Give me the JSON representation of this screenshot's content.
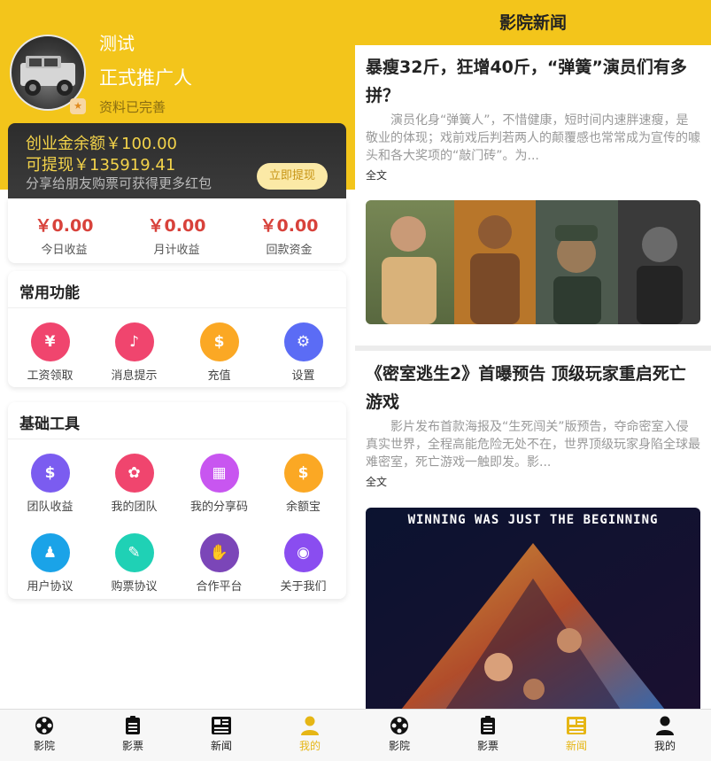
{
  "profile": {
    "name": "测试",
    "role": "正式推广人",
    "status": "资料已完善",
    "badge_icon": "★"
  },
  "wallet": {
    "balance_text": "创业金余额￥100.00",
    "withdrawable_text": "可提现￥135919.41",
    "hint": "分享给朋友购票可获得更多红包",
    "withdraw_button": "立即提现"
  },
  "stats": [
    {
      "value": "￥0.00",
      "label": "今日收益"
    },
    {
      "value": "￥0.00",
      "label": "月计收益"
    },
    {
      "value": "￥0.00",
      "label": "回款资金"
    }
  ],
  "common": {
    "title": "常用功能",
    "items": [
      {
        "label": "工资领取",
        "icon": "wallet-icon",
        "glyph": "¥",
        "color": "#f0456e"
      },
      {
        "label": "消息提示",
        "icon": "bell-icon",
        "glyph": "♪",
        "color": "#f0456e"
      },
      {
        "label": "充值",
        "icon": "coin-icon",
        "glyph": "$",
        "color": "#fba824"
      },
      {
        "label": "设置",
        "icon": "gear-icon",
        "glyph": "⚙",
        "color": "#5b6cf5"
      }
    ]
  },
  "tools": {
    "title": "基础工具",
    "items": [
      {
        "label": "团队收益",
        "icon": "money-bag-icon",
        "glyph": "$",
        "color": "#7b5cf0"
      },
      {
        "label": "我的团队",
        "icon": "award-icon",
        "glyph": "✿",
        "color": "#f0456e"
      },
      {
        "label": "我的分享码",
        "icon": "qrcode-icon",
        "glyph": "▦",
        "color": "#c856f0"
      },
      {
        "label": "余额宝",
        "icon": "money-bag-icon",
        "glyph": "$",
        "color": "#fba824"
      },
      {
        "label": "用户协议",
        "icon": "user-bag-icon",
        "glyph": "♟",
        "color": "#1aa3e8"
      },
      {
        "label": "购票协议",
        "icon": "pen-icon",
        "glyph": "✎",
        "color": "#1fd1b5"
      },
      {
        "label": "合作平台",
        "icon": "handshake-icon",
        "glyph": "✋",
        "color": "#7b46b8"
      },
      {
        "label": "关于我们",
        "icon": "lock-icon",
        "glyph": "◉",
        "color": "#8a4df0"
      }
    ]
  },
  "tabbar_left": [
    {
      "label": "影院",
      "icon": "film-reel-icon"
    },
    {
      "label": "影票",
      "icon": "ticket-icon"
    },
    {
      "label": "新闻",
      "icon": "news-icon"
    },
    {
      "label": "我的",
      "icon": "user-icon",
      "active": true
    }
  ],
  "news": {
    "header": "影院新闻",
    "articles": [
      {
        "title": "暴瘦32斤，狂增40斤，“弹簧”演员们有多拼？",
        "summary": "演员化身“弹簧人”，不惜健康，短时间内速胖速瘦，是敬业的体现；戏前戏后判若两人的颠覆感也常常成为宣传的噱头和各大奖项的“敲门砖”。为...",
        "more": "全文"
      },
      {
        "title": "《密室逃生2》首曝预告 顶级玩家重启死亡游戏",
        "summary": "影片发布首款海报及“生死闯关”版预告，夺命密室入侵真实世界，全程高能危险无处不在，世界顶级玩家身陷全球最难密室，死亡游戏一触即发。影...",
        "more": "全文",
        "poster_text": "WINNING WAS JUST THE BEGINNING"
      }
    ]
  },
  "tabbar_right": [
    {
      "label": "影院",
      "icon": "film-reel-icon"
    },
    {
      "label": "影票",
      "icon": "ticket-icon"
    },
    {
      "label": "新闻",
      "icon": "news-icon",
      "active": true
    },
    {
      "label": "我的",
      "icon": "user-icon"
    }
  ],
  "colors": {
    "brand_yellow": "#f3c51b",
    "money_red": "#d8423b",
    "active_tab": "#e6b615"
  }
}
